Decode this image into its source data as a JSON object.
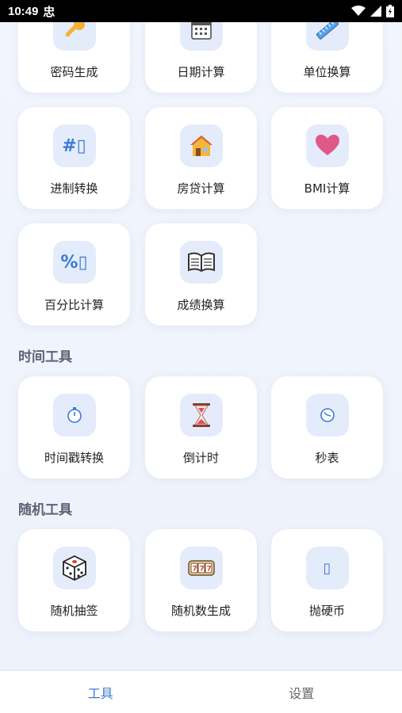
{
  "status_bar": {
    "time": "10:49",
    "app_glyph": "忠"
  },
  "sections": {
    "time_tools": "时间工具",
    "random_tools": "随机工具"
  },
  "cards": {
    "password": "密码生成",
    "date_calc": "日期计算",
    "unit_convert": "单位换算",
    "base_convert": "进制转换",
    "mortgage": "房贷计算",
    "bmi": "BMI计算",
    "percent": "百分比计算",
    "grade": "成绩换算",
    "timestamp": "时间戳转换",
    "countdown": "倒计时",
    "stopwatch": "秒表",
    "lottery": "随机抽签",
    "random_number": "随机数生成",
    "coin_flip": "抛硬币"
  },
  "icon_text": {
    "base_convert": "#▯",
    "percent": "%▯",
    "coin_flip": "▯"
  },
  "bottom_nav": {
    "tools": "工具",
    "settings": "设置"
  },
  "colors": {
    "accent": "#3a7bd5",
    "tile_bg": "#e4ecfb"
  }
}
